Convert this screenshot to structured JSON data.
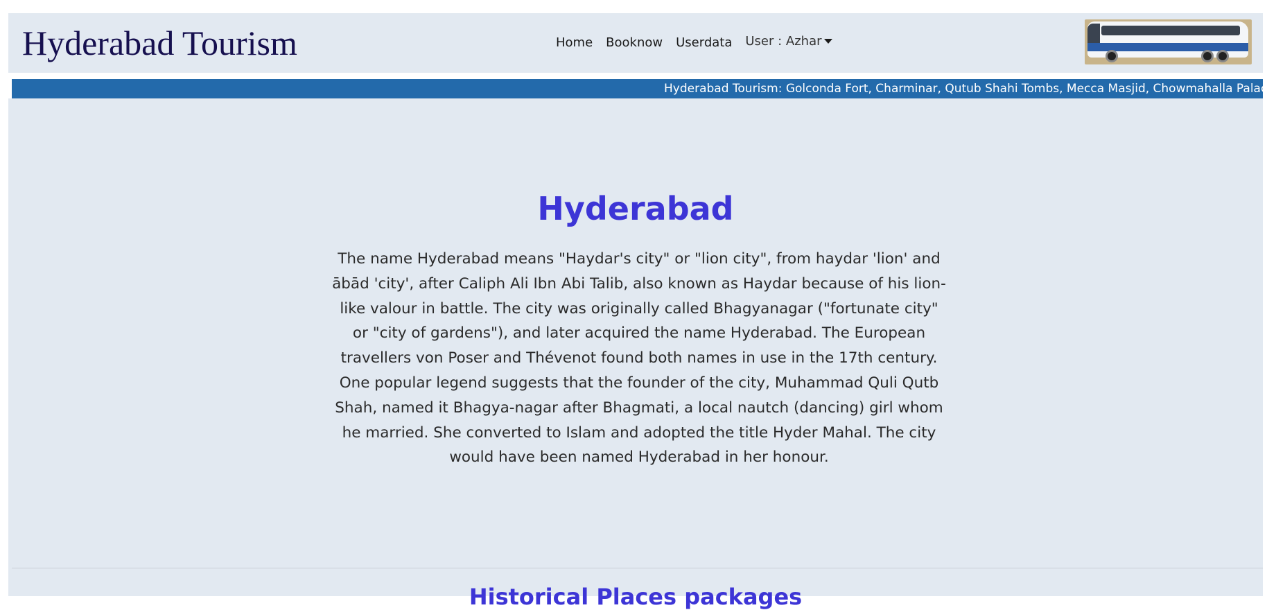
{
  "header": {
    "brand": "Hyderabad Tourism",
    "nav": {
      "home": "Home",
      "booknow": "Booknow",
      "userdata": "Userdata",
      "user": "User : Azhar"
    }
  },
  "marquee": {
    "text": "Hyderabad Tourism: Golconda Fort, Charminar, Qutub Shahi Tombs, Mecca Masjid, Chowmahalla Palac"
  },
  "main": {
    "title": "Hyderabad",
    "description": "The name Hyderabad means \"Haydar's city\" or \"lion city\", from haydar 'lion' and ābād 'city', after Caliph Ali Ibn Abi Talib, also known as Haydar because of his lion-like valour in battle. The city was originally called Bhagyanagar (\"fortunate city\" or \"city of gardens\"), and later acquired the name Hyderabad. The European travellers von Poser and Thévenot found both names in use in the 17th century. One popular legend suggests that the founder of the city, Muhammad Quli Qutb Shah, named it Bhagya-nagar after Bhagmati, a local nautch (dancing) girl whom he married. She converted to Islam and adopted the title Hyder Mahal. The city would have been named Hyderabad in her honour.",
    "section_title": "Historical Places packages"
  },
  "colors": {
    "navbar_bg": "#e2e9f1",
    "marquee_bg": "#236aab",
    "heading": "#3d35d6",
    "brand": "#16104f"
  },
  "icons": {
    "dropdown": "caret-down-icon",
    "logo_image": "bus-image"
  }
}
